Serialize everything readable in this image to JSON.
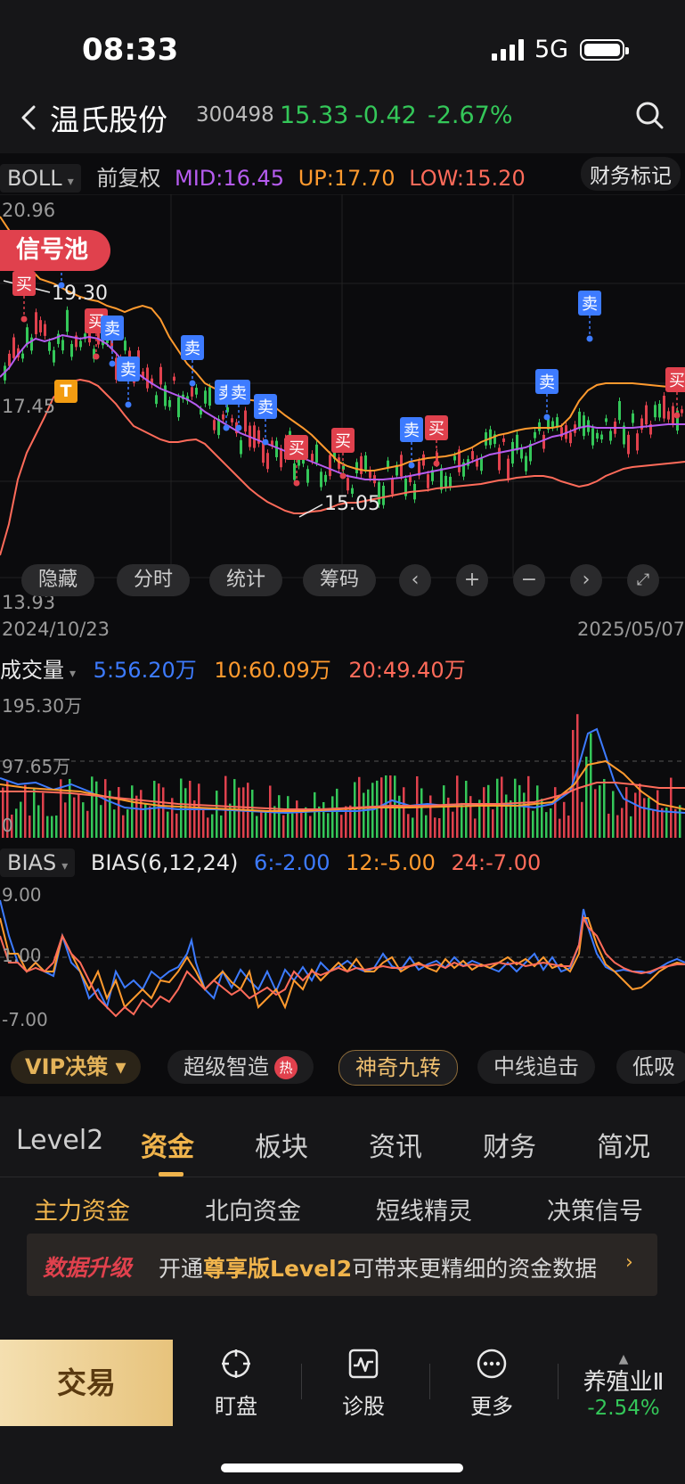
{
  "status_bar": {
    "time": "08:33",
    "network": "5G"
  },
  "header": {
    "stock_name": "温氏股份",
    "stock_code": "300498",
    "price": "15.33",
    "change": "-0.42",
    "change_pct": "-2.67%"
  },
  "main_chart": {
    "indicator": "BOLL",
    "adjust": "前复权",
    "mid": "MID:16.45",
    "up": "UP:17.70",
    "low": "LOW:15.20",
    "finance_mark": "财务标记",
    "y_labels": {
      "top": "20.96",
      "mid": "17.45",
      "bottom": "13.93"
    },
    "date_start": "2024/10/23",
    "date_end": "2025/05/07",
    "high_label": "19.30",
    "low_label": "15.05",
    "signal_pool": "信号池",
    "buttons": {
      "hide": "隐藏",
      "intraday": "分时",
      "stats": "统计",
      "chips": "筹码"
    },
    "marker_t": "T",
    "buy_label": "买",
    "sell_label": "卖"
  },
  "volume_chart": {
    "label": "成交量",
    "ma5": "5:56.20万",
    "ma10": "10:60.09万",
    "ma20": "20:49.40万",
    "y_top": "195.30万",
    "y_mid": "97.65万",
    "y_zero": "0"
  },
  "bias_chart": {
    "label": "BIAS",
    "params": "BIAS(6,12,24)",
    "b6": "6:-2.00",
    "b12": "12:-5.00",
    "b24": "24:-7.00",
    "y_top": "9.00",
    "y_mid": "1.00",
    "y_bottom": "-7.00"
  },
  "strategy_bar": {
    "vip": "VIP决策",
    "hot_badge": "热",
    "items": [
      "超级智造",
      "神奇九转",
      "中线追击",
      "低吸"
    ]
  },
  "tabs": [
    "Level2",
    "资金",
    "板块",
    "资讯",
    "财务",
    "简况"
  ],
  "subtabs": [
    "主力资金",
    "北向资金",
    "短线精灵",
    "决策信号"
  ],
  "upgrade": {
    "title": "数据升级",
    "text_pre": "开通",
    "text_hl": "尊享版Level2",
    "text_post": "可带来更精细的资金数据"
  },
  "bottom_nav": {
    "trade": "交易",
    "watch": "盯盘",
    "diagnose": "诊股",
    "more": "更多",
    "sector_name": "养殖业Ⅱ",
    "sector_change": "-2.54%"
  },
  "colors": {
    "up_red": "#e0414d",
    "down_green": "#34c759",
    "mid_purple": "#b65cf0",
    "upper_orange": "#ff9a2e",
    "lower_red": "#ff6b5a",
    "accent_gold": "#f0b44c",
    "blue": "#3d7bff"
  }
}
